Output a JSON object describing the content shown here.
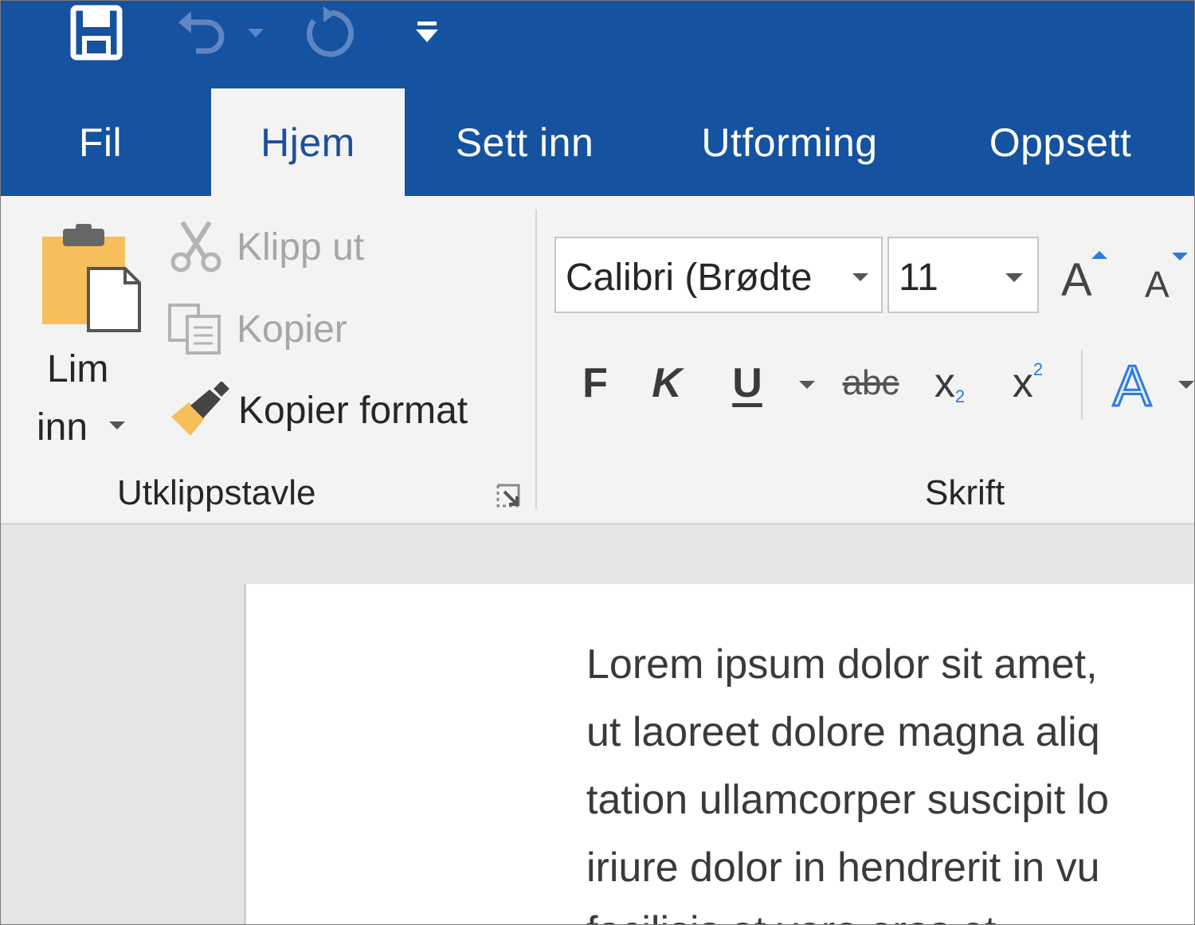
{
  "quick_access": {
    "save": "save-icon",
    "undo": "undo-icon",
    "redo": "redo-icon",
    "customize": "customize-icon"
  },
  "tabs": [
    {
      "label": "Fil",
      "active": false
    },
    {
      "label": "Hjem",
      "active": true
    },
    {
      "label": "Sett inn",
      "active": false
    },
    {
      "label": "Utforming",
      "active": false
    },
    {
      "label": "Oppsett",
      "active": false
    }
  ],
  "clipboard": {
    "paste_line1": "Lim",
    "paste_line2": "inn",
    "cut": "Klipp ut",
    "copy": "Kopier",
    "format_painter": "Kopier format",
    "group_label": "Utklippstavle"
  },
  "font": {
    "font_name": "Calibri (Brødte",
    "font_size": "11",
    "bold": "F",
    "italic": "K",
    "underline": "U",
    "strikethrough": "abc",
    "subscript": "x",
    "superscript": "x",
    "group_label": "Skrift"
  },
  "document": {
    "lines": [
      "Lorem ipsum dolor sit amet,",
      "ut laoreet dolore magna aliq",
      "tation ullamcorper suscipit lo",
      "iriure dolor in hendrerit in vu",
      "facilisis at vero eros et"
    ]
  },
  "colors": {
    "title_blue": "#1552a0",
    "ribbon_bg": "#f3f3f3",
    "active_tab_text": "#1d4f9a",
    "paste_orange": "#f6bf5b",
    "text_effect_blue": "#2f7bd6"
  }
}
